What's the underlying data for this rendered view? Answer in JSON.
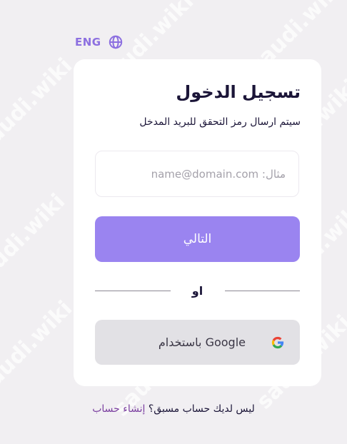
{
  "language": {
    "label": "ENG",
    "icon": "globe-icon"
  },
  "login": {
    "title": "تسجيل الدخول",
    "subtitle": "سيتم ارسال رمز التحقق للبريد المدخل",
    "email_placeholder": "مثال: name@domain.com",
    "email_value": "",
    "next_label": "التالي",
    "divider_label": "او",
    "google_label": "باستخدام Google",
    "google_icon": "google-icon"
  },
  "signup": {
    "prompt": "ليس لديك حساب مسبق؟",
    "link_label": "إنشاء حساب"
  },
  "watermark": {
    "text": "saudi.wiki"
  },
  "colors": {
    "accent": "#9a84f0",
    "link": "#7b3fa0",
    "page_background": "#f1eff2",
    "card_background": "#ffffff",
    "google_button_background": "#e2e1e5",
    "text_primary": "#1b1538"
  }
}
